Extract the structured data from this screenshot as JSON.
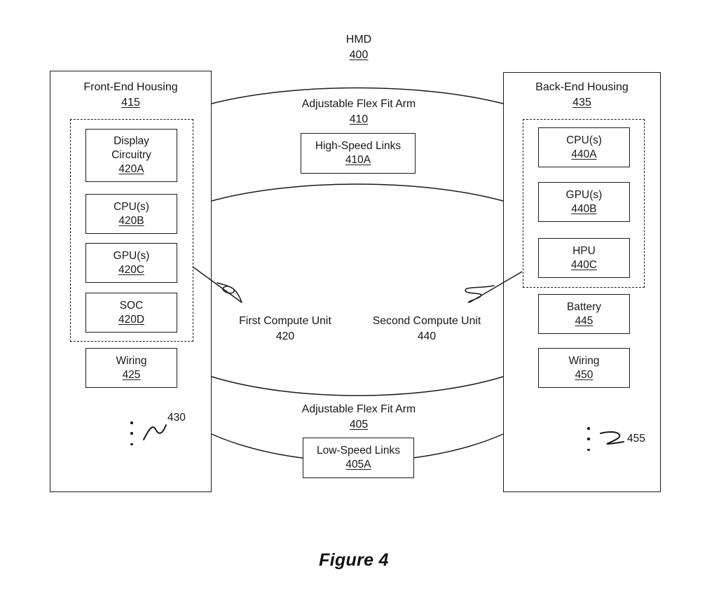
{
  "figure": {
    "caption": "Figure 4",
    "device_title": "HMD",
    "device_number": "400"
  },
  "front_housing": {
    "title": "Front-End Housing",
    "number": "415",
    "compute_unit": {
      "label": "First Compute Unit",
      "number": "420"
    },
    "components": [
      {
        "name": "Display Circuitry",
        "line1": "Display",
        "line2": "Circuitry",
        "number": "420A"
      },
      {
        "name": "CPU(s)",
        "line1": "CPU(s)",
        "line2": "",
        "number": "420B"
      },
      {
        "name": "GPU(s)",
        "line1": "GPU(s)",
        "line2": "",
        "number": "420C"
      },
      {
        "name": "SOC",
        "line1": "SOC",
        "line2": "",
        "number": "420D"
      }
    ],
    "wiring": {
      "name": "Wiring",
      "number": "425"
    },
    "more_marker": "430"
  },
  "back_housing": {
    "title": "Back-End Housing",
    "number": "435",
    "compute_unit": {
      "label": "Second Compute Unit",
      "number": "440"
    },
    "components": [
      {
        "name": "CPU(s)",
        "number": "440A"
      },
      {
        "name": "GPU(s)",
        "number": "440B"
      },
      {
        "name": "HPU",
        "number": "440C"
      }
    ],
    "battery": {
      "name": "Battery",
      "number": "445"
    },
    "wiring": {
      "name": "Wiring",
      "number": "450"
    },
    "more_marker": "455"
  },
  "top_arm": {
    "title": "Adjustable Flex Fit Arm",
    "number": "410",
    "links": {
      "name": "High-Speed Links",
      "number": "410A"
    }
  },
  "bottom_arm": {
    "title": "Adjustable Flex Fit Arm",
    "number": "405",
    "links": {
      "name": "Low-Speed Links",
      "number": "405A"
    }
  },
  "colors": {
    "ink": "#1a1a1a",
    "background": "#ffffff"
  }
}
